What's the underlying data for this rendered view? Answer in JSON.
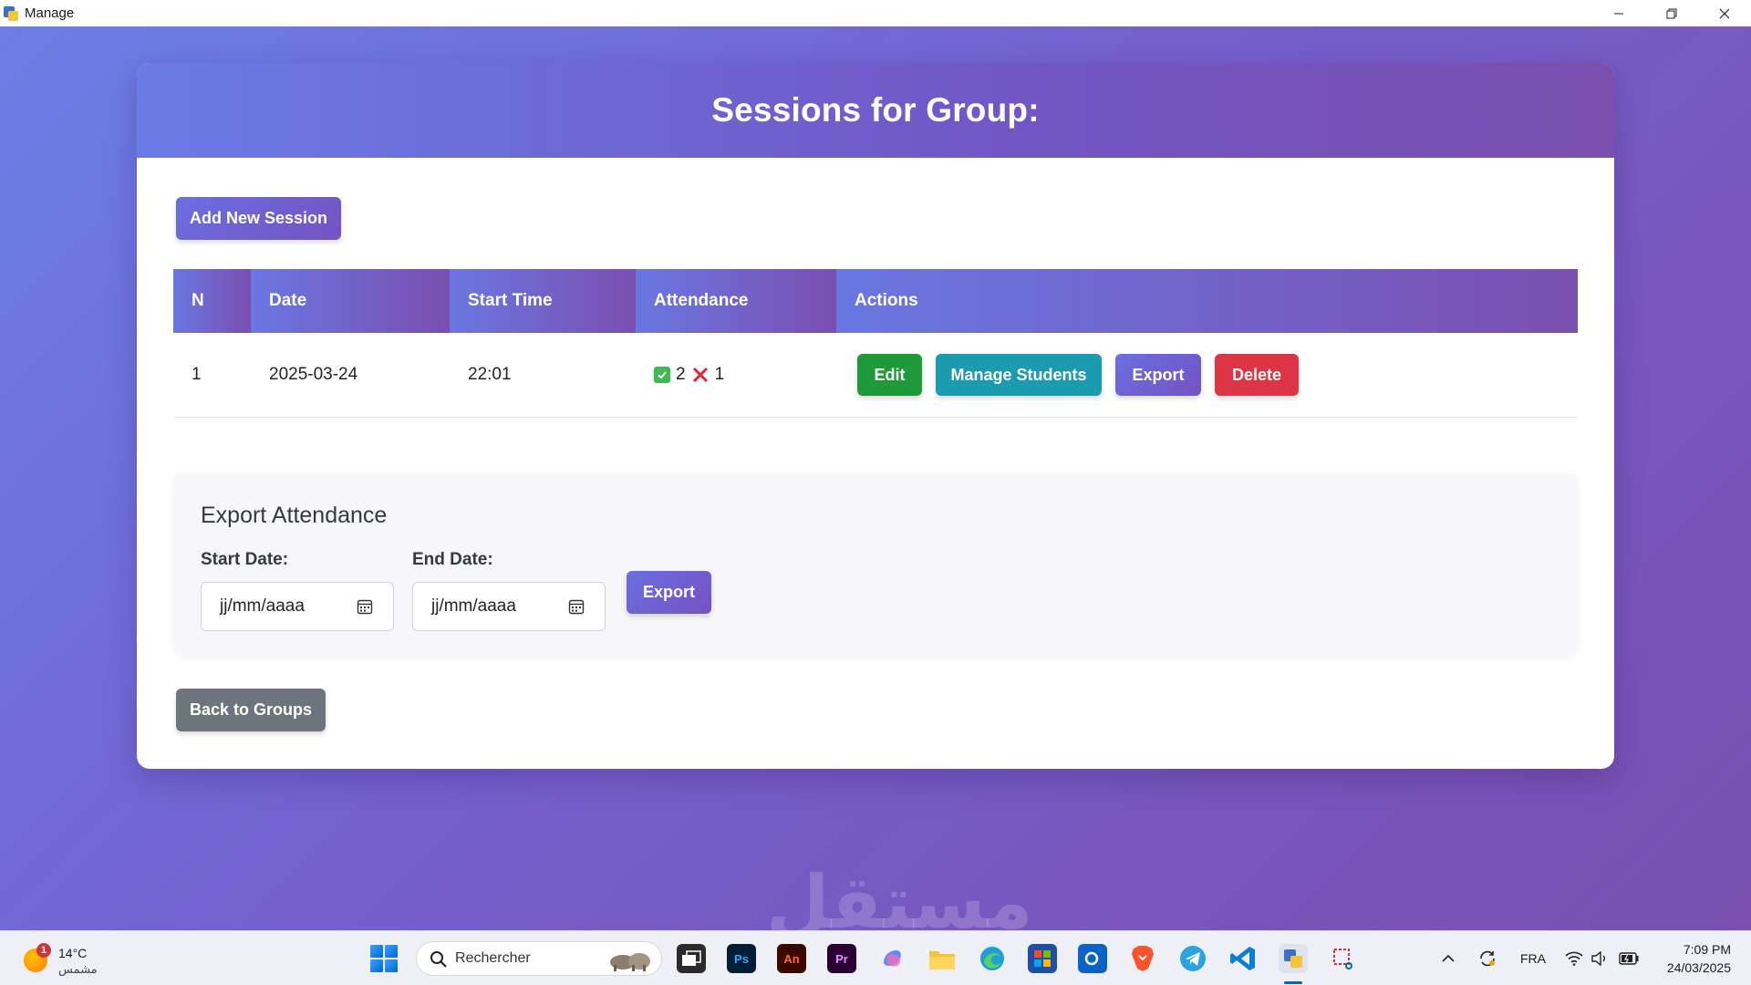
{
  "window": {
    "title": "Manage"
  },
  "header": {
    "title": "Sessions for Group:"
  },
  "buttons": {
    "add_session": "Add New Session",
    "back": "Back to Groups"
  },
  "table": {
    "headers": [
      "N",
      "Date",
      "Start Time",
      "Attendance",
      "Actions"
    ],
    "rows": [
      {
        "n": "1",
        "date": "2025-03-24",
        "start_time": "22:01",
        "present": "2",
        "absent": "1",
        "actions": [
          "Edit",
          "Manage Students",
          "Export",
          "Delete"
        ]
      }
    ]
  },
  "export": {
    "title": "Export Attendance",
    "start_label": "Start Date:",
    "end_label": "End Date:",
    "start_placeholder": "jj/mm/aaaa",
    "end_placeholder": "jj/mm/aaaa",
    "button": "Export"
  },
  "watermark": "مستقل",
  "taskbar": {
    "weather_temp": "14°C",
    "weather_condition": "مشمس",
    "weather_badge": "1",
    "search_placeholder": "Rechercher",
    "apps": [
      "Ps",
      "An",
      "Pr"
    ],
    "language": "FRA",
    "time": "7:09 PM",
    "date": "24/03/2025"
  },
  "colors": {
    "accent_start": "#6a7be6",
    "accent_end": "#7a4fae",
    "success": "#1f9a3a",
    "info": "#1a9bb0",
    "danger": "#dc3545",
    "secondary": "#6c757d"
  }
}
